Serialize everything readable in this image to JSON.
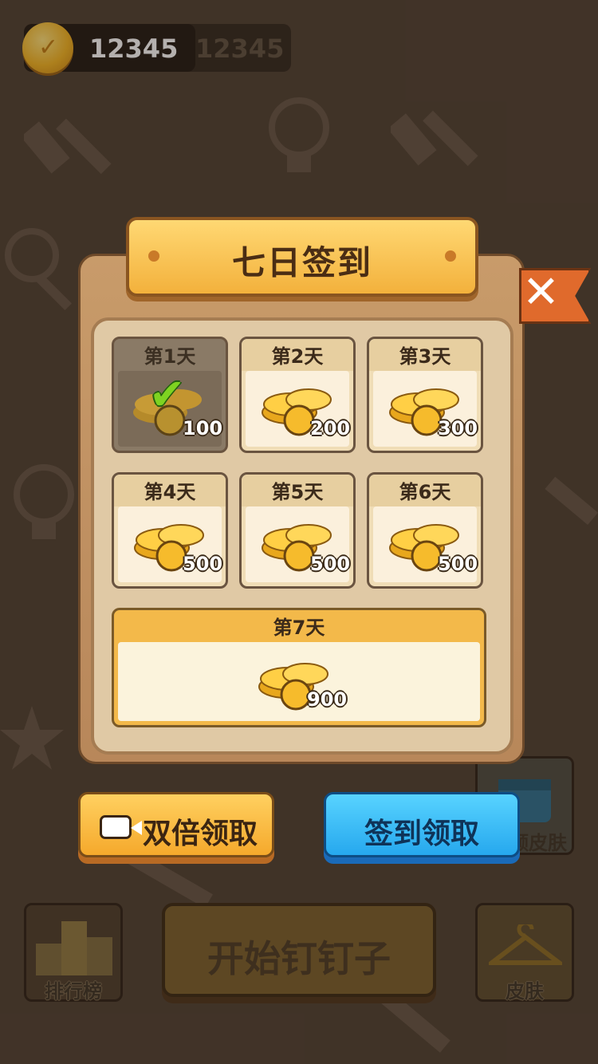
{
  "header": {
    "coin_count": "12345",
    "coin_count_shadow": "12345"
  },
  "dialog": {
    "title": "七日签到",
    "close_icon": "close-x-icon",
    "days": [
      {
        "label": "第1天",
        "amount": "100",
        "claimed": true
      },
      {
        "label": "第2天",
        "amount": "200",
        "claimed": false
      },
      {
        "label": "第3天",
        "amount": "300",
        "claimed": false
      },
      {
        "label": "第4天",
        "amount": "500",
        "claimed": false
      },
      {
        "label": "第5天",
        "amount": "500",
        "claimed": false
      },
      {
        "label": "第6天",
        "amount": "500",
        "claimed": false
      },
      {
        "label": "第7天",
        "amount": "900",
        "claimed": false
      }
    ],
    "double_claim_label": "双倍领取",
    "sign_claim_label": "签到领取"
  },
  "background_ui": {
    "start_label": "开始钉钉子",
    "rank_label": "排行榜",
    "skin_label": "皮肤",
    "collect_skin_label": "领皮肤"
  },
  "colors": {
    "gold": "#f4b521",
    "blue_button": "#26a8ee",
    "orange_button": "#f5a92c",
    "panel_wood": "#c89b6a"
  }
}
